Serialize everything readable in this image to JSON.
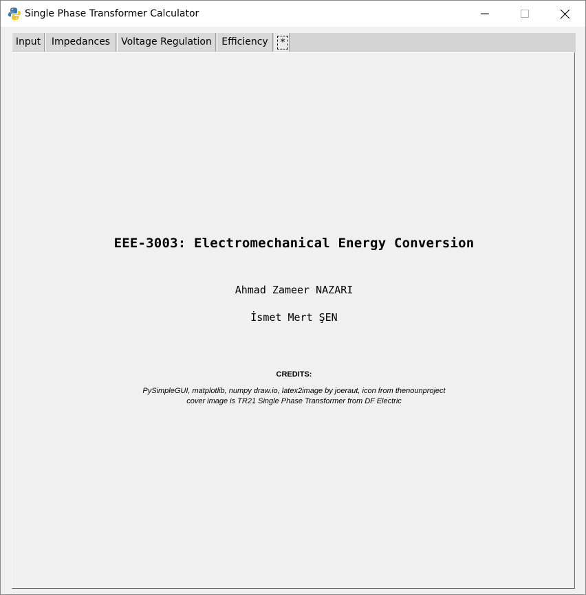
{
  "window": {
    "title": "Single Phase Transformer Calculator"
  },
  "tabs": [
    {
      "label": "Input"
    },
    {
      "label": "Impedances"
    },
    {
      "label": "Voltage Regulation"
    },
    {
      "label": "Efficiency"
    },
    {
      "label": "*"
    }
  ],
  "about": {
    "course_title": "EEE-3003: Electromechanical Energy Conversion",
    "authors": [
      "Ahmad Zameer NAZARI",
      "İsmet Mert ŞEN"
    ],
    "credits_heading": "CREDITS:",
    "credits_lines": [
      "PySimpleGUI, matplotlib, numpy draw.io, latex2image by joeraut, icon from thenounproject",
      "cover image is TR21 Single Phase Transformer from DF Electric"
    ]
  },
  "icons": {
    "app": "python-app-icon",
    "minimize": "minimize-icon",
    "maximize": "maximize-icon",
    "close": "close-icon"
  },
  "colors": {
    "background": "#f0f0f0",
    "tabstrip": "#d4d4d4",
    "titlebar": "#ffffff"
  }
}
